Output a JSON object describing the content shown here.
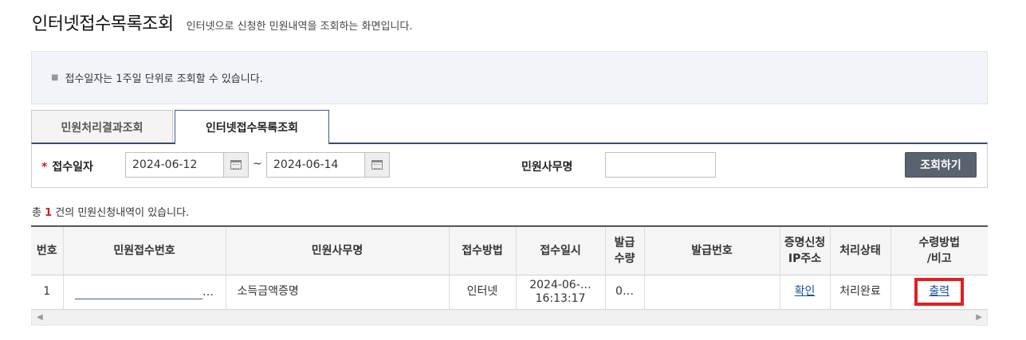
{
  "header": {
    "title": "인터넷접수목록조회",
    "description": "인터넷으로 신청한 민원내역을 조회하는 화면입니다."
  },
  "notice": {
    "text": "접수일자는 1주일 단위로 조회할 수 있습니다."
  },
  "tabs": [
    {
      "label": "민원처리결과조회",
      "active": false
    },
    {
      "label": "인터넷접수목록조회",
      "active": true
    }
  ],
  "search": {
    "required_mark": "*",
    "date_label": "접수일자",
    "date_from": "2024-06-12",
    "date_to": "2024-06-14",
    "tilde": "~",
    "office_label": "민원사무명",
    "office_value": "",
    "button_label": "조회하기"
  },
  "summary": {
    "prefix": "총",
    "count": "1",
    "suffix": "건의 민원신청내역이 있습니다."
  },
  "table": {
    "headers": {
      "no": "번호",
      "receipt_no": "민원접수번호",
      "office": "민원사무명",
      "method": "접수방법",
      "datetime": "접수일시",
      "qty_line1": "발급",
      "qty_line2": "수량",
      "issue_no": "발급번호",
      "ip_line1": "증명신청",
      "ip_line2": "IP주소",
      "status": "처리상태",
      "receive_line1": "수령방법",
      "receive_line2": "/비고"
    },
    "rows": [
      {
        "no": "1",
        "receipt_no_suffix": "…",
        "office": "소득금액증명",
        "method": "인터넷",
        "datetime_line1": "2024-06-…",
        "datetime_line2": "16:13:17",
        "qty": "0…",
        "issue_no": "",
        "ip": "확인",
        "status": "처리완료",
        "receive": "출력"
      }
    ]
  },
  "colors": {
    "required": "#d21a1a",
    "link": "#1a4fa0",
    "highlight_box": "#e02020",
    "search_button": "#5a6270"
  }
}
